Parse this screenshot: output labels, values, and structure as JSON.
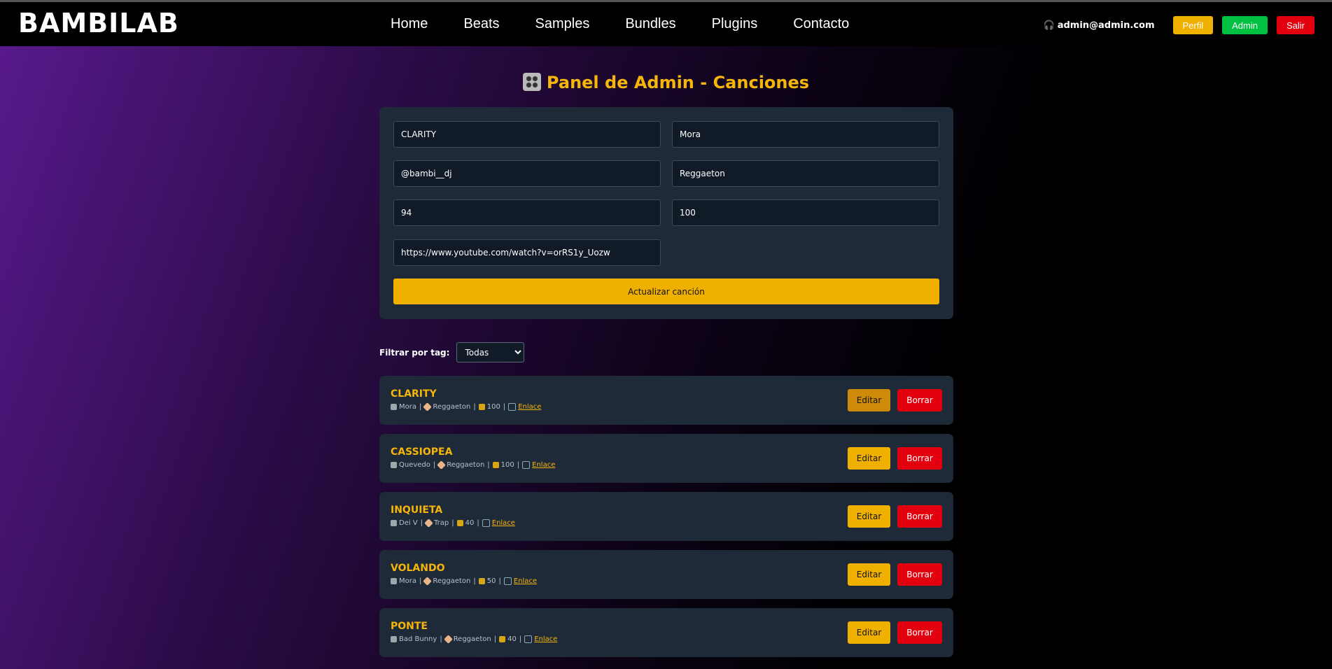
{
  "navbar": {
    "brand": "BAMBILAB",
    "links": [
      "Home",
      "Beats",
      "Samples",
      "Bundles",
      "Plugins",
      "Contacto"
    ],
    "user_email": "admin@admin.com",
    "buttons": {
      "perfil": "Perfil",
      "admin": "Admin",
      "salir": "Salir"
    }
  },
  "page_title": "Panel de Admin - Canciones",
  "form": {
    "title_value": "CLARITY",
    "artist_value": "Mora",
    "producer_value": "@bambi__dj",
    "genre_value": "Reggaeton",
    "bpm_value": "94",
    "price_value": "100",
    "url_value": "https://www.youtube.com/watch?v=orRS1y_Uozw",
    "submit_label": "Actualizar canción"
  },
  "filter": {
    "label": "Filtrar por tag:",
    "selected": "Todas"
  },
  "songs": [
    {
      "name": "CLARITY",
      "artist": "Mora",
      "tag": "Reggaeton",
      "price": "100",
      "link": "Enlace"
    },
    {
      "name": "CASSIOPEA",
      "artist": "Quevedo",
      "tag": "Reggaeton",
      "price": "100",
      "link": "Enlace"
    },
    {
      "name": "INQUIETA",
      "artist": "Dei V",
      "tag": "Trap",
      "price": "40",
      "link": "Enlace"
    },
    {
      "name": "VOLANDO",
      "artist": "Mora",
      "tag": "Reggaeton",
      "price": "50",
      "link": "Enlace"
    },
    {
      "name": "PONTE",
      "artist": "Bad Bunny",
      "tag": "Reggaeton",
      "price": "40",
      "link": "Enlace"
    }
  ],
  "song_actions": {
    "edit": "Editar",
    "delete": "Borrar"
  },
  "colors": {
    "accent": "#f5b50a",
    "danger": "#e2000f",
    "success": "#00c140",
    "card": "#1e2a38"
  }
}
